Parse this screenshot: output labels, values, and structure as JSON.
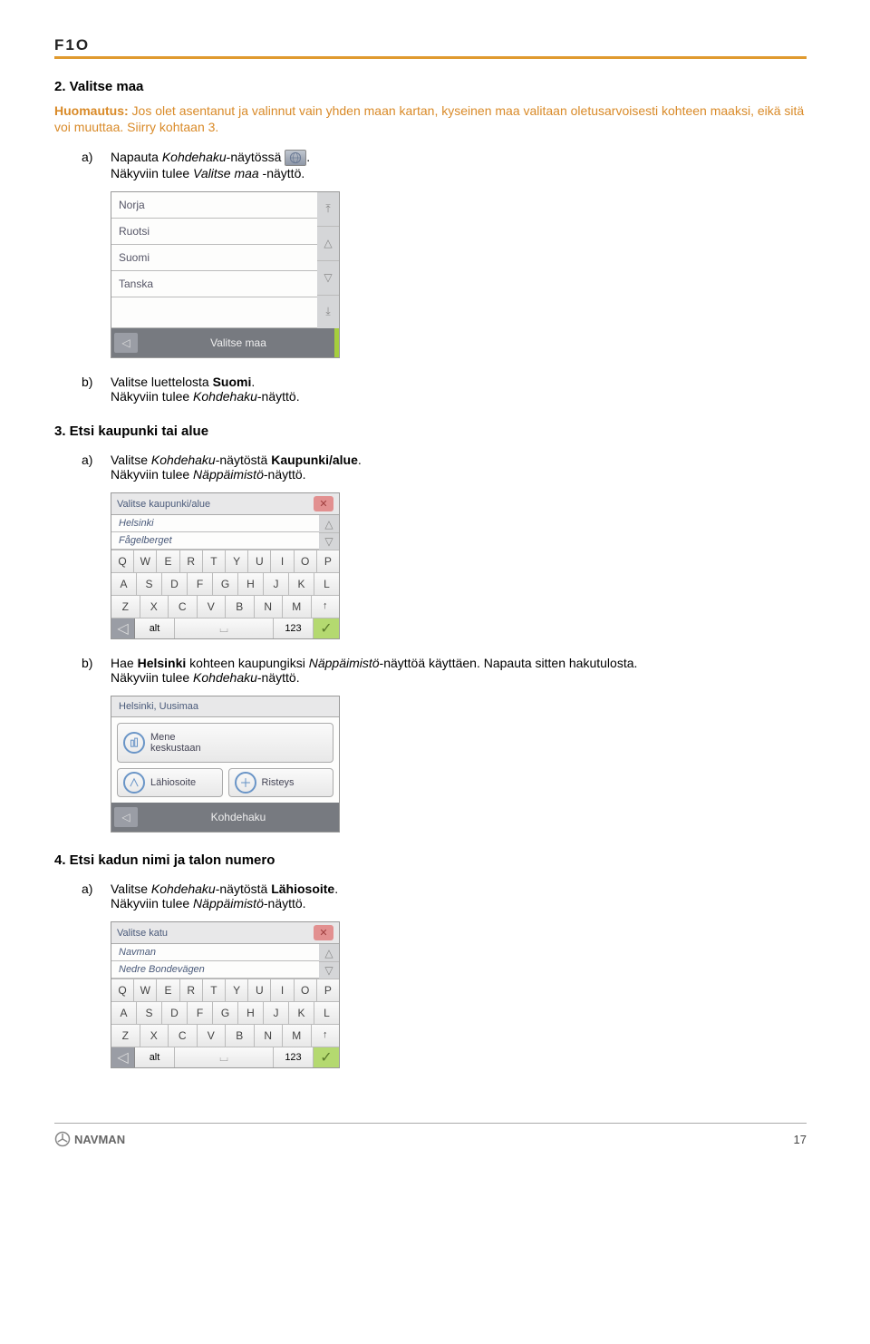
{
  "header": {
    "product": "F1O"
  },
  "s2": {
    "title": "2. Valitse maa",
    "note_label": "Huomautus:",
    "note_text": " Jos olet asentanut ja valinnut vain yhden maan kartan, kyseinen maa valitaan oletusarvoisesti kohteen maaksi, eikä sitä voi muuttaa. Siirry kohtaan 3.",
    "a_pre": "Napauta ",
    "a_italic": "Kohdehaku",
    "a_post": "-näytössä ",
    "a_end": ".",
    "a_line2_pre": "Näkyviin tulee ",
    "a_line2_italic": "Valitse maa",
    "a_line2_post": " -näyttö.",
    "countries": [
      "Norja",
      "Ruotsi",
      "Suomi",
      "Tanska"
    ],
    "bottom_label": "Valitse maa",
    "b_pre": "Valitse luettelosta ",
    "b_bold": "Suomi",
    "b_post": ".",
    "b_line2_pre": "Näkyviin tulee ",
    "b_line2_italic": "Kohdehaku",
    "b_line2_post": "-näyttö."
  },
  "s3": {
    "title": "3. Etsi kaupunki tai alue",
    "a_pre": "Valitse ",
    "a_italic": "Kohdehaku",
    "a_mid": "-näytöstä ",
    "a_bold": "Kaupunki/alue",
    "a_post": ".",
    "a_line2_pre": "Näkyviin tulee ",
    "a_line2_italic": "Näppäimistö",
    "a_line2_post": "-näyttö.",
    "kb1_title": "Valitse kaupunki/alue",
    "kb1_suggestions": [
      "Helsinki",
      "Fågelberget"
    ],
    "kb_row1": [
      "Q",
      "W",
      "E",
      "R",
      "T",
      "Y",
      "U",
      "I",
      "O",
      "P"
    ],
    "kb_row2": [
      "A",
      "S",
      "D",
      "F",
      "G",
      "H",
      "J",
      "K",
      "L"
    ],
    "kb_row3": [
      "Z",
      "X",
      "C",
      "V",
      "B",
      "N",
      "M",
      "↑"
    ],
    "kb_alt": "alt",
    "kb_space": "⌴",
    "kb_123": "123",
    "b_pre": "Hae ",
    "b_bold": "Helsinki",
    "b_mid": " kohteen kaupungiksi ",
    "b_italic": "Näppäimistö",
    "b_post": "-näyttöä käyttäen. Napauta sitten hakutulosta.",
    "b_line2_pre": "Näkyviin tulee ",
    "b_line2_italic": "Kohdehaku",
    "b_line2_post": "-näyttö.",
    "dest_title": "Helsinki, Uusimaa",
    "dest_btn1_l1": "Mene",
    "dest_btn1_l2": "keskustaan",
    "dest_btn2": "Lähiosoite",
    "dest_btn3": "Risteys",
    "dest_bottom": "Kohdehaku"
  },
  "s4": {
    "title": "4. Etsi kadun nimi ja talon numero",
    "a_pre": "Valitse ",
    "a_italic": "Kohdehaku",
    "a_mid": "-näytöstä ",
    "a_bold": "Lähiosoite",
    "a_post": ".",
    "a_line2_pre": "Näkyviin tulee ",
    "a_line2_italic": "Näppäimistö",
    "a_line2_post": "-näyttö.",
    "kb2_title": "Valitse katu",
    "kb2_suggestions": [
      "Navman",
      "Nedre Bondevägen"
    ]
  },
  "footer": {
    "brand": "NAVMAN",
    "page": "17"
  }
}
